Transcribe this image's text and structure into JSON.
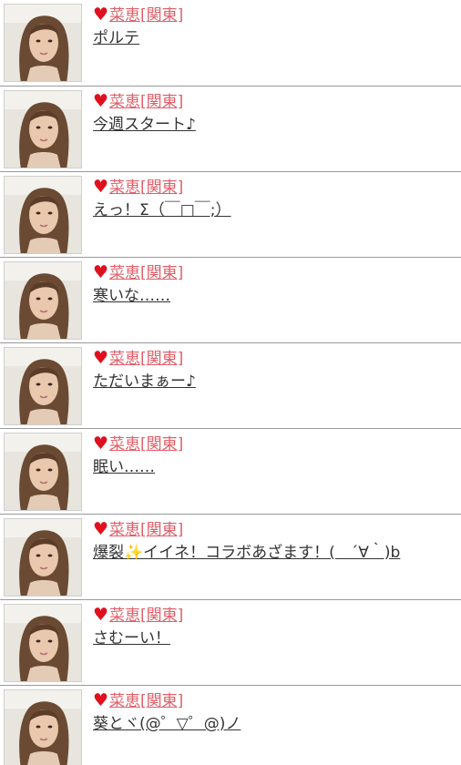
{
  "feed": {
    "entries": [
      {
        "author_mark": "♥",
        "author": "菜恵[関東]",
        "message": "ポルテ"
      },
      {
        "author_mark": "♥",
        "author": "菜恵[関東]",
        "message": "今週スタート♪"
      },
      {
        "author_mark": "♥",
        "author": "菜恵[関東]",
        "message": "えっ！Σ（￣□￣;）"
      },
      {
        "author_mark": "♥",
        "author": "菜恵[関東]",
        "message": "寒いな……"
      },
      {
        "author_mark": "♥",
        "author": "菜恵[関東]",
        "message": "ただいまぁー♪"
      },
      {
        "author_mark": "♥",
        "author": "菜恵[関東]",
        "message": "眠い……"
      },
      {
        "author_mark": "♥",
        "author": "菜恵[関東]",
        "message": "爆裂✨イイネ！コラボあざます！(　´∀｀)b"
      },
      {
        "author_mark": "♥",
        "author": "菜恵[関東]",
        "message": "さむーい！"
      },
      {
        "author_mark": "♥",
        "author": "菜恵[関東]",
        "message": "葵とヾ(@゜▽゜@)ノ"
      }
    ]
  },
  "colors": {
    "author_link": "#e0606a",
    "heart": "#e0101e",
    "message_text": "#333333",
    "divider": "#999999"
  },
  "icons": {
    "author_mark": "heart-icon",
    "avatar": "user-avatar-photo"
  }
}
